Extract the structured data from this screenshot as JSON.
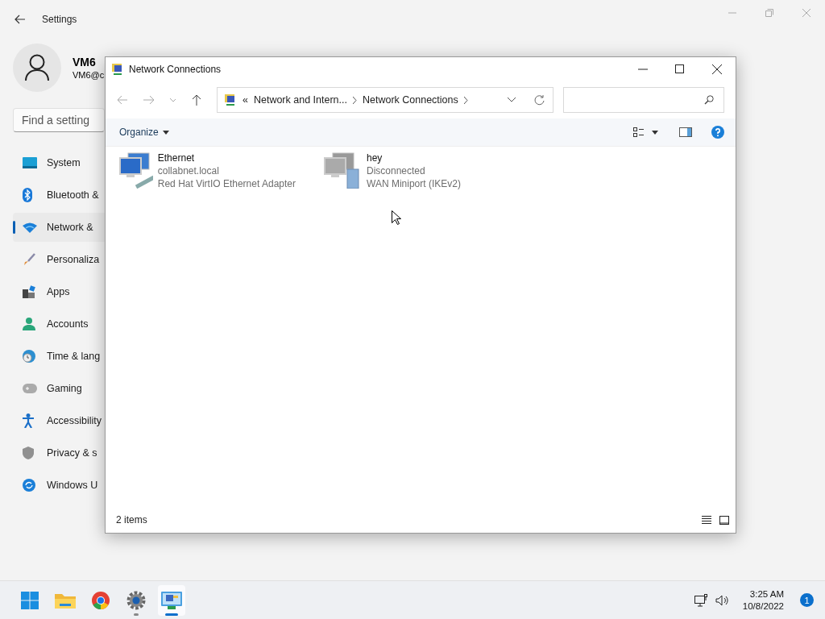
{
  "settings": {
    "title": "Settings",
    "user": {
      "name": "VM6",
      "email": "VM6@c"
    },
    "search": {
      "placeholder": "Find a setting"
    },
    "nav": [
      {
        "label": "System",
        "selected": false
      },
      {
        "label": "Bluetooth &",
        "selected": false
      },
      {
        "label": "Network &",
        "selected": true
      },
      {
        "label": "Personaliza",
        "selected": false
      },
      {
        "label": "Apps",
        "selected": false
      },
      {
        "label": "Accounts",
        "selected": false
      },
      {
        "label": "Time & lang",
        "selected": false
      },
      {
        "label": "Gaming",
        "selected": false
      },
      {
        "label": "Accessibility",
        "selected": false
      },
      {
        "label": "Privacy & s",
        "selected": false
      },
      {
        "label": "Windows U",
        "selected": false
      }
    ]
  },
  "explorer": {
    "title": "Network Connections",
    "breadcrumb": {
      "overflow": "«",
      "parts": [
        "Network and Intern...",
        "Network Connections"
      ]
    },
    "toolbar": {
      "organize": "Organize"
    },
    "items": [
      {
        "kind": "ethernet",
        "name": "Ethernet",
        "status": "collabnet.local",
        "device": "Red Hat VirtIO Ethernet Adapter"
      },
      {
        "kind": "wan",
        "name": "hey",
        "status": "Disconnected",
        "device": "WAN Miniport (IKEv2)"
      }
    ],
    "status_bar": "2 items"
  },
  "taskbar": {
    "apps": [
      {
        "kind": "start",
        "selected": false,
        "running": false
      },
      {
        "kind": "folder",
        "selected": false,
        "running": false
      },
      {
        "kind": "browser",
        "selected": false,
        "running": false
      },
      {
        "kind": "gear",
        "selected": false,
        "running": true
      },
      {
        "kind": "network",
        "selected": true,
        "running": true
      }
    ],
    "time": "3:25 AM",
    "date": "10/8/2022",
    "notifications": "1"
  }
}
